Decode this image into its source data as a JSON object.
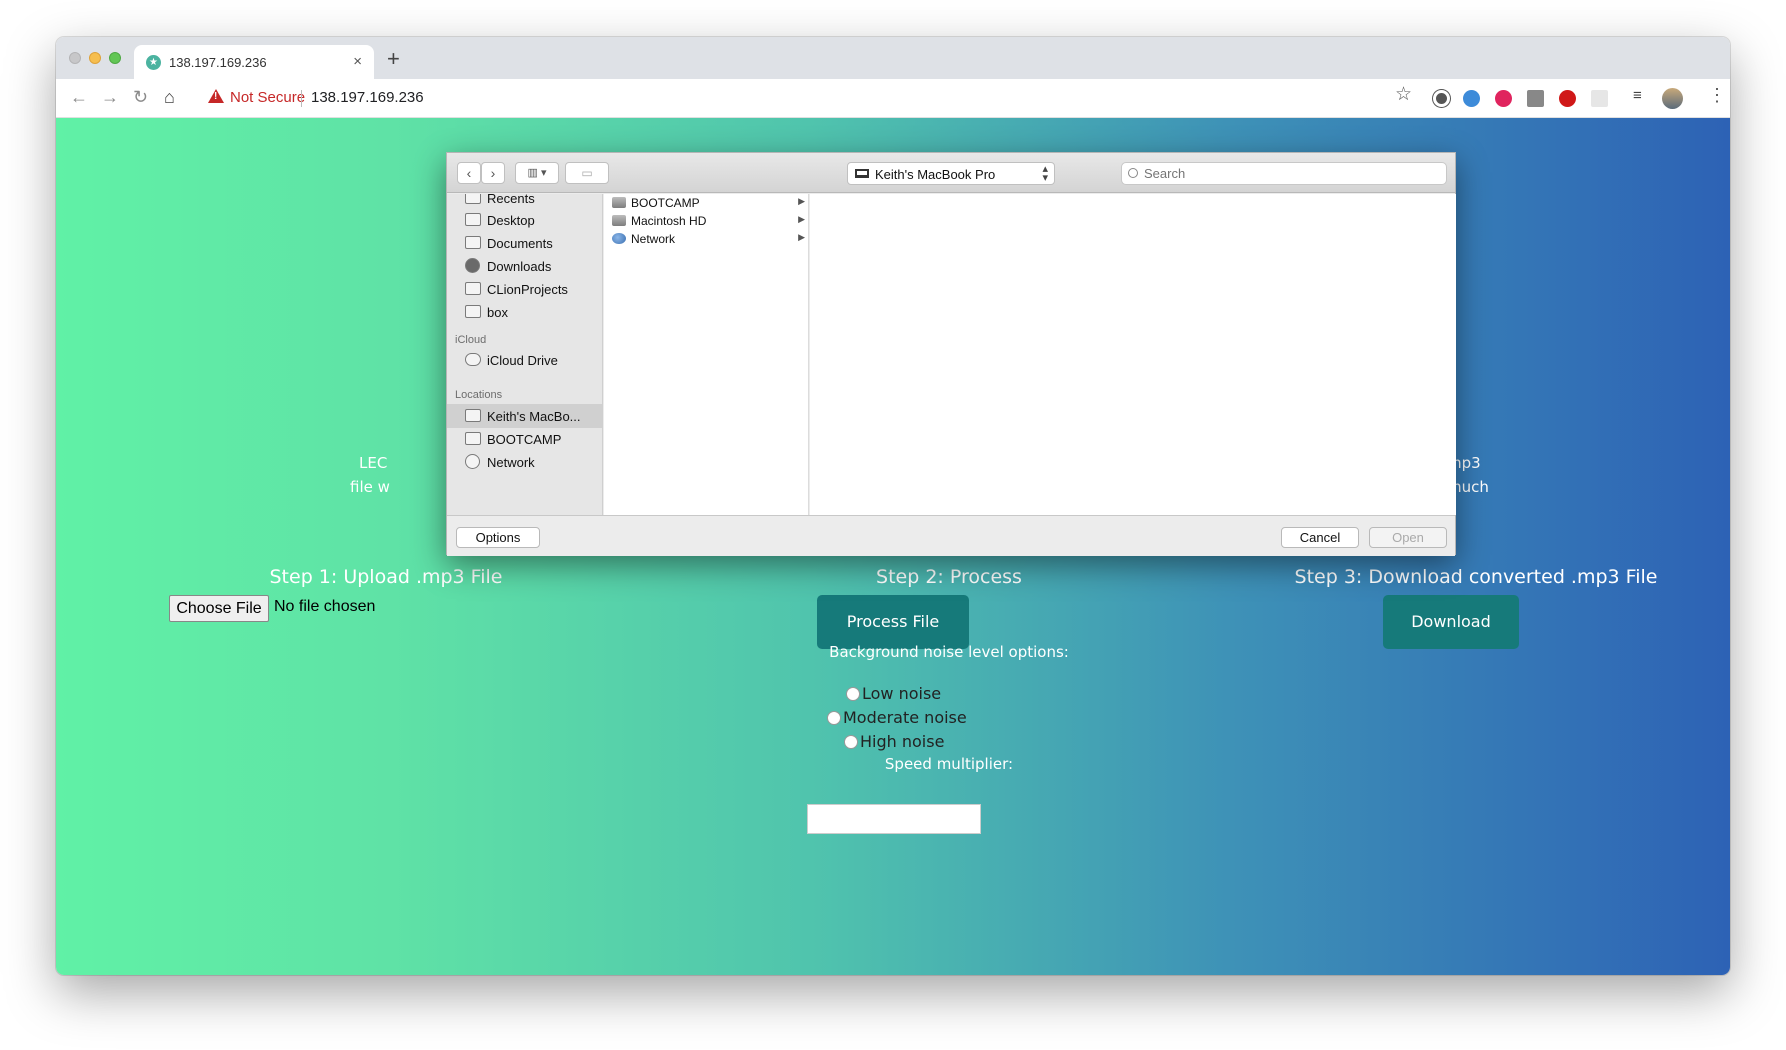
{
  "browser": {
    "tab_title": "138.197.169.236",
    "tab_close": "×",
    "new_tab": "+",
    "security_label": "Not Secure",
    "url": "138.197.169.236"
  },
  "page": {
    "partial_left_line1": "LEC",
    "partial_left_line2": "file w",
    "partial_right_line1": "mp3",
    "partial_right_line2": "much",
    "step1_title": "Step 1: Upload .mp3 File",
    "choose_file_label": "Choose File",
    "no_file_label": "No file chosen",
    "step2_title": "Step 2: Process",
    "process_button": "Process File",
    "noise_label": "Background noise level options:",
    "noise_options": [
      "Low noise",
      "Moderate noise",
      "High noise"
    ],
    "speed_label": "Speed multiplier:",
    "speed_value": "",
    "step3_title": "Step 3: Download converted .mp3 File",
    "download_button": "Download",
    "gradient_start": "#60f1a6",
    "gradient_end": "#2d62b5",
    "button_color": "#167a7a"
  },
  "dialog": {
    "location": "Keith's MacBook Pro",
    "search_placeholder": "Search",
    "sidebar": {
      "favorites": [
        "Recents",
        "Desktop",
        "Documents",
        "Downloads",
        "CLionProjects",
        "box"
      ],
      "icloud_header": "iCloud",
      "icloud_items": [
        "iCloud Drive"
      ],
      "locations_header": "Locations",
      "locations": [
        "Keith's MacBo...",
        "BOOTCAMP",
        "Network"
      ]
    },
    "column_items": [
      "BOOTCAMP",
      "Macintosh HD",
      "Network"
    ],
    "options_button": "Options",
    "cancel_button": "Cancel",
    "open_button": "Open"
  }
}
